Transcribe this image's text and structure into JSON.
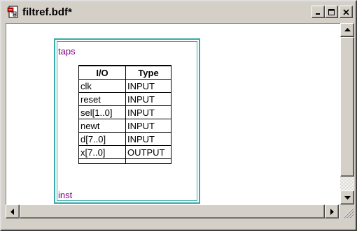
{
  "window": {
    "title": "filtref.bdf*",
    "icon": "bdf-document-icon",
    "controls": {
      "minimize_icon": "minimize-icon",
      "maximize_icon": "maximize-icon",
      "close_icon": "close-icon"
    }
  },
  "symbol": {
    "name": "taps",
    "instance": "inst",
    "border_color": "#3aa8a8",
    "label_color": "#800080",
    "table": {
      "headers": [
        "I/O",
        "Type"
      ],
      "rows": [
        [
          "clk",
          "INPUT"
        ],
        [
          "reset",
          "INPUT"
        ],
        [
          "sel[1..0]",
          "INPUT"
        ],
        [
          "newt",
          "INPUT"
        ],
        [
          "d[7..0]",
          "INPUT"
        ],
        [
          "x[7..0]",
          "OUTPUT"
        ]
      ]
    }
  },
  "scrollbars": {
    "up_icon": "arrow-up-icon",
    "down_icon": "arrow-down-icon",
    "left_icon": "arrow-left-icon",
    "right_icon": "arrow-right-icon"
  }
}
